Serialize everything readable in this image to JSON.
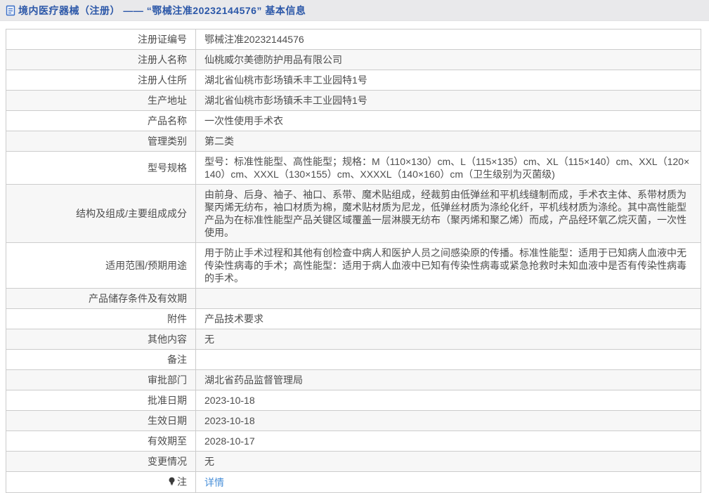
{
  "page": {
    "title": "境内医疗器械（注册） ——  “鄂械注准20232144576”  基本信息"
  },
  "colors": {
    "title_blue": "#2b57a8",
    "link_blue": "#4a90d9",
    "header_bg": "#e9e9eb",
    "stripe_bg": "#f7f7f7",
    "border": "#cccccc",
    "text": "#4d4d4d"
  },
  "icons": {
    "title_icon": "document-icon",
    "note_icon": "lightbulb-icon"
  },
  "table": {
    "rows": [
      {
        "label": "注册证编号",
        "value": "鄂械注准20232144576",
        "type": "text"
      },
      {
        "label": "注册人名称",
        "value": "仙桃威尔美德防护用品有限公司",
        "type": "text"
      },
      {
        "label": "注册人住所",
        "value": "湖北省仙桃市彭场镇禾丰工业园特1号",
        "type": "text"
      },
      {
        "label": "生产地址",
        "value": "湖北省仙桃市彭场镇禾丰工业园特1号",
        "type": "text"
      },
      {
        "label": "产品名称",
        "value": "一次性使用手术衣",
        "type": "text"
      },
      {
        "label": "管理类别",
        "value": "第二类",
        "type": "text"
      },
      {
        "label": "型号规格",
        "value": "型号：标准性能型、高性能型；规格：M（110×130）cm、L（115×135）cm、XL（115×140）cm、XXL（120×140）cm、XXXL（130×155）cm、XXXXL（140×160）cm（卫生级别为灭菌级)",
        "type": "text"
      },
      {
        "label": "结构及组成/主要组成成分",
        "value": "由前身、后身、袖子、袖口、系带、魔术贴组成，经裁剪由低弹丝和平机线缝制而成，手术衣主体、系带材质为聚丙烯无纺布，袖口材质为棉，魔术贴材质为尼龙，低弹丝材质为涤纶化纤，平机线材质为涤纶。其中高性能型产品为在标准性能型产品关键区域覆盖一层淋膜无纺布（聚丙烯和聚乙烯）而成，产品经环氧乙烷灭菌，一次性使用。",
        "type": "text"
      },
      {
        "label": "适用范围/预期用途",
        "value": "用于防止手术过程和其他有创检查中病人和医护人员之间感染原的传播。标准性能型：适用于已知病人血液中无传染性病毒的手术；高性能型：适用于病人血液中已知有传染性病毒或紧急抢救时未知血液中是否有传染性病毒的手术。",
        "type": "text"
      },
      {
        "label": "产品储存条件及有效期",
        "value": "",
        "type": "text"
      },
      {
        "label": "附件",
        "value": "产品技术要求",
        "type": "text"
      },
      {
        "label": "其他内容",
        "value": "无",
        "type": "text"
      },
      {
        "label": "备注",
        "value": "",
        "type": "text"
      },
      {
        "label": "审批部门",
        "value": "湖北省药品监督管理局",
        "type": "text"
      },
      {
        "label": "批准日期",
        "value": "2023-10-18",
        "type": "text"
      },
      {
        "label": "生效日期",
        "value": "2023-10-18",
        "type": "text"
      },
      {
        "label": "有效期至",
        "value": "2028-10-17",
        "type": "text"
      },
      {
        "label": "变更情况",
        "value": "无",
        "type": "text"
      },
      {
        "label": "注",
        "label_icon": "lightbulb-icon",
        "value": "详情",
        "type": "link"
      }
    ]
  }
}
